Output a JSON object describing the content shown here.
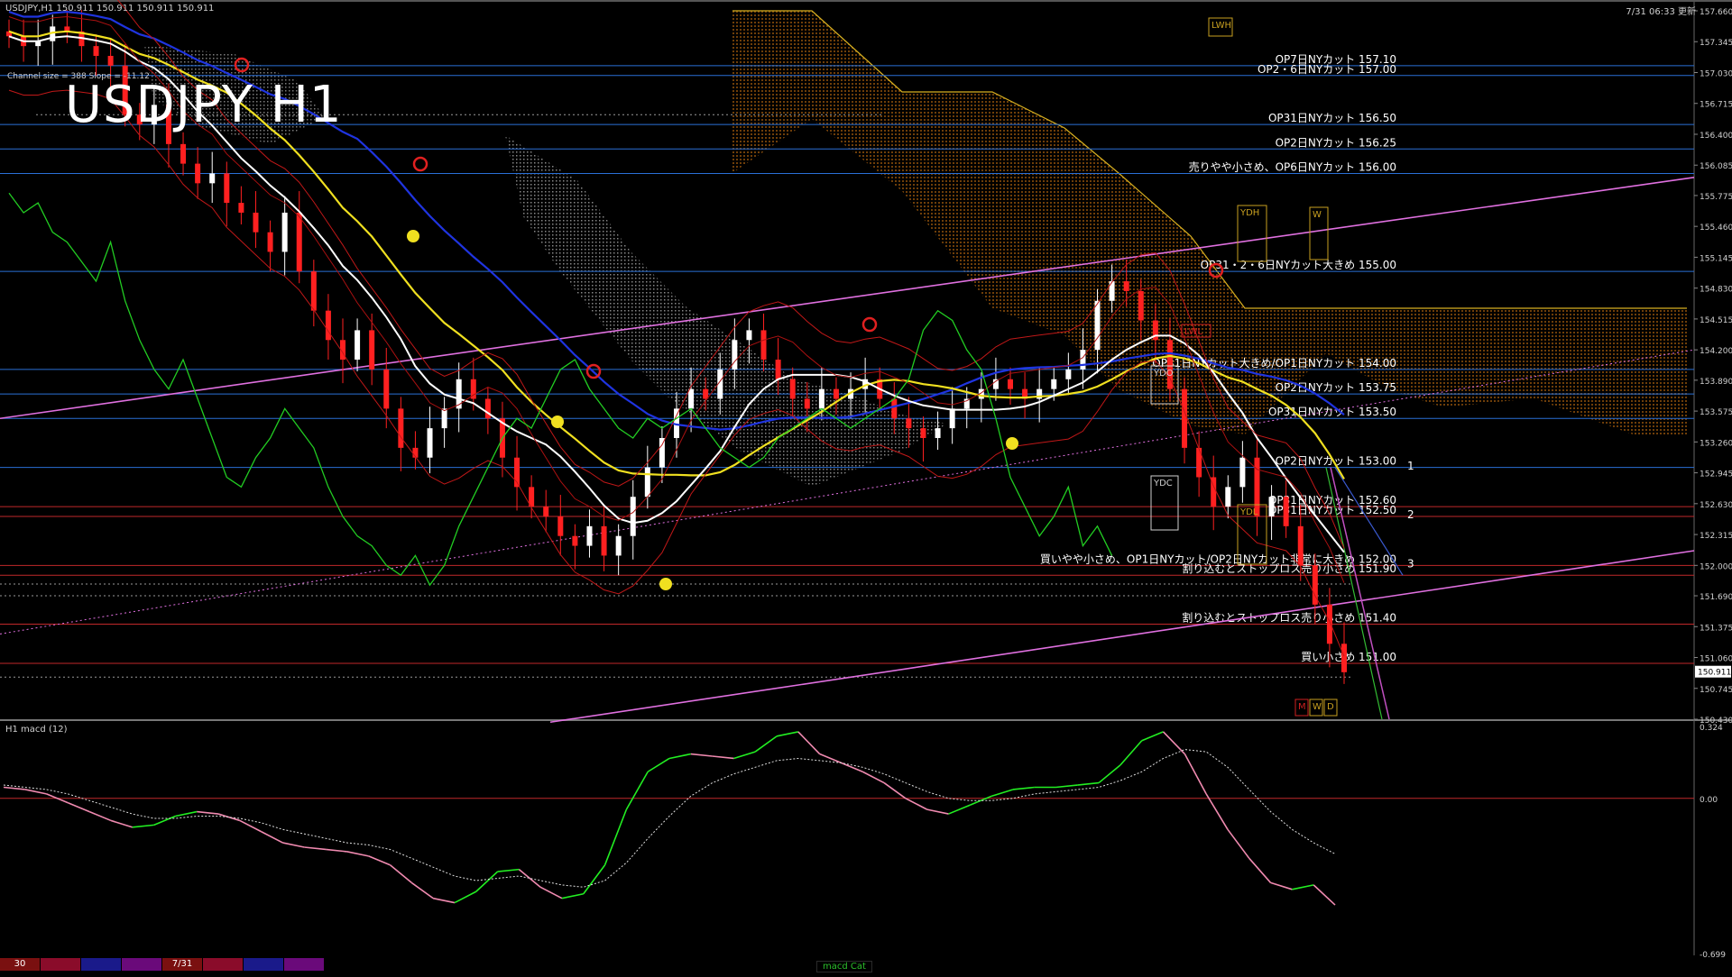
{
  "header": {
    "symbol_info": "USDJPY,H1  150.911 150.911 150.911 150.911",
    "server_time": "7/31 06:33 更新",
    "channel_info": "Channel size = 388 Slope = -11.12",
    "big_title": "USDJPY H1"
  },
  "colors": {
    "background": "#000000",
    "hline_blue": "#2a6fd6",
    "hline_red": "#c0282a",
    "channel_magenta": "#e070e0",
    "sma_white": "#ffffff",
    "sma_yellow": "#f0e020",
    "sma_blue": "#1f34e0",
    "bollinger_red": "#c01818",
    "chikou_green": "#22cc22",
    "kumo_orange": "#c87010",
    "kumo_white": "#e0e0e0",
    "macd_green": "#22ee22",
    "macd_pink": "#f08ab0",
    "bull_candle": "#ffffff",
    "bear_candle": "#ff2020"
  },
  "chart_data": {
    "type": "candlestick",
    "symbol": "USDJPY",
    "timeframe": "H1",
    "last_price": 150.911,
    "ylim": [
      150.43,
      157.66
    ],
    "y_ticks": [
      "157.660",
      "157.345",
      "157.030",
      "156.715",
      "156.400",
      "156.085",
      "155.775",
      "155.460",
      "155.145",
      "154.830",
      "154.515",
      "154.200",
      "153.890",
      "153.575",
      "153.260",
      "152.945",
      "152.630",
      "152.315",
      "152.000",
      "151.690",
      "151.375",
      "151.060",
      "150.745",
      "150.430"
    ],
    "candles_close_approx": [
      157.4,
      157.3,
      157.35,
      157.5,
      157.45,
      157.3,
      157.2,
      157.1,
      156.6,
      156.5,
      156.7,
      156.3,
      156.1,
      155.9,
      156.0,
      155.7,
      155.6,
      155.4,
      155.2,
      155.6,
      155.0,
      154.6,
      154.3,
      154.1,
      154.4,
      154.0,
      153.6,
      153.2,
      153.1,
      153.4,
      153.6,
      153.9,
      153.7,
      153.5,
      153.1,
      152.8,
      152.6,
      152.5,
      152.3,
      152.2,
      152.4,
      152.1,
      152.3,
      152.7,
      153.0,
      153.3,
      153.6,
      153.8,
      153.7,
      154.0,
      154.3,
      154.4,
      154.1,
      153.9,
      153.7,
      153.6,
      153.8,
      153.7,
      153.8,
      153.9,
      153.7,
      153.5,
      153.4,
      153.3,
      153.4,
      153.6,
      153.7,
      153.8,
      153.9,
      153.8,
      153.7,
      153.8,
      153.9,
      154.0,
      154.2,
      154.7,
      154.9,
      154.8,
      154.5,
      154.3,
      153.8,
      153.2,
      152.9,
      152.6,
      152.8,
      153.1,
      152.5,
      152.7,
      152.4,
      152.0,
      151.6,
      151.2,
      150.91
    ],
    "hlines": [
      {
        "label": "OP7日NYカット 157.10",
        "value": 157.1,
        "color": "blue"
      },
      {
        "label": "OP2・6日NYカット 157.00",
        "value": 157.0,
        "color": "blue"
      },
      {
        "label": "OP31日NYカット 156.50",
        "value": 156.5,
        "color": "blue"
      },
      {
        "label": "OP2日NYカット 156.25",
        "value": 156.25,
        "color": "blue"
      },
      {
        "label": "売りやや小さめ、OP6日NYカット 156.00",
        "value": 156.0,
        "color": "blue"
      },
      {
        "label": "OP31・2・6日NYカット大きめ 155.00",
        "value": 155.0,
        "color": "blue"
      },
      {
        "label": "OP31日NYカット大きめ/OP1日NYカット 154.00",
        "value": 154.0,
        "color": "blue"
      },
      {
        "label": "OP2日NYカット 153.75",
        "value": 153.75,
        "color": "blue"
      },
      {
        "label": "OP31日NYカット 153.50",
        "value": 153.5,
        "color": "blue"
      },
      {
        "label": "OP2日NYカット 153.00",
        "value": 153.0,
        "color": "blue"
      },
      {
        "label": "OP31日NYカット 152.60",
        "value": 152.6,
        "color": "red"
      },
      {
        "label": "OP31日NYカット 152.50",
        "value": 152.5,
        "color": "red"
      },
      {
        "label": "買いやや小さめ、OP1日NYカット/OP2日NYカット非常に大きめ 152.00",
        "value": 152.0,
        "color": "red"
      },
      {
        "label": "割り込むとストップロス売り小さめ 151.90",
        "value": 151.9,
        "color": "red"
      },
      {
        "label": "割り込むとストップロス売り小さめ 151.40",
        "value": 151.4,
        "color": "red"
      },
      {
        "label": "買い小さめ 151.00",
        "value": 151.0,
        "color": "red"
      }
    ],
    "channel_labels": [
      "1",
      "2",
      "3"
    ],
    "box_labels": [
      "LWH",
      "YDH",
      "W",
      "LWL",
      "YDO",
      "YDC",
      "YDL",
      "M",
      "W",
      "D"
    ]
  },
  "macd": {
    "title": "H1 macd (12)",
    "ylim": [
      -0.699,
      0.324
    ],
    "y_ticks": [
      "0.324",
      "0.00",
      "-0.699"
    ],
    "main_values": [
      0.05,
      0.04,
      0.02,
      -0.02,
      -0.06,
      -0.1,
      -0.13,
      -0.12,
      -0.08,
      -0.06,
      -0.07,
      -0.1,
      -0.15,
      -0.2,
      -0.22,
      -0.23,
      -0.24,
      -0.26,
      -0.3,
      -0.38,
      -0.45,
      -0.47,
      -0.42,
      -0.33,
      -0.32,
      -0.4,
      -0.45,
      -0.43,
      -0.3,
      -0.05,
      0.12,
      0.18,
      0.2,
      0.19,
      0.18,
      0.21,
      0.28,
      0.3,
      0.2,
      0.16,
      0.12,
      0.07,
      0.0,
      -0.05,
      -0.07,
      -0.03,
      0.01,
      0.04,
      0.05,
      0.05,
      0.06,
      0.07,
      0.15,
      0.26,
      0.3,
      0.2,
      0.02,
      -0.14,
      -0.27,
      -0.38,
      -0.41,
      -0.39,
      -0.48
    ],
    "signal_values": [
      0.06,
      0.05,
      0.04,
      0.02,
      -0.01,
      -0.04,
      -0.07,
      -0.09,
      -0.09,
      -0.08,
      -0.08,
      -0.09,
      -0.11,
      -0.14,
      -0.16,
      -0.18,
      -0.2,
      -0.21,
      -0.23,
      -0.27,
      -0.31,
      -0.35,
      -0.37,
      -0.36,
      -0.35,
      -0.37,
      -0.39,
      -0.4,
      -0.37,
      -0.29,
      -0.18,
      -0.08,
      0.01,
      0.07,
      0.11,
      0.14,
      0.17,
      0.18,
      0.17,
      0.16,
      0.14,
      0.11,
      0.07,
      0.03,
      0.0,
      -0.01,
      -0.01,
      0.0,
      0.02,
      0.03,
      0.04,
      0.05,
      0.08,
      0.12,
      0.18,
      0.22,
      0.21,
      0.14,
      0.04,
      -0.06,
      -0.14,
      -0.2,
      -0.25
    ]
  },
  "tabs": [
    {
      "label": "30",
      "color": "#7a1010"
    },
    {
      "label": "",
      "color": "#8a0c2a"
    },
    {
      "label": "",
      "color": "#1a1a8a"
    },
    {
      "label": "",
      "color": "#6a0a7a"
    },
    {
      "label": "7/31",
      "color": "#7a1010"
    },
    {
      "label": "",
      "color": "#8a0c2a"
    },
    {
      "label": "",
      "color": "#1a1a8a"
    },
    {
      "label": "",
      "color": "#6a0a7a"
    }
  ],
  "bottom_status": "macd Cat"
}
